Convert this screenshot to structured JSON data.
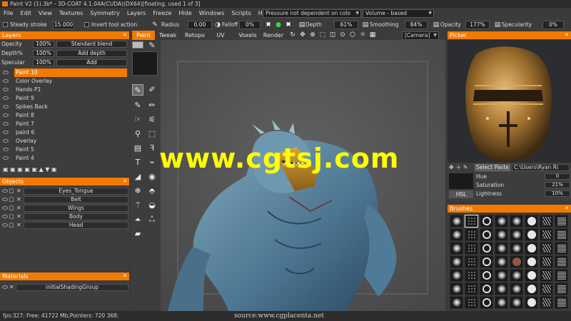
{
  "window": {
    "title": "Paint V2 (1).3b* - 3D-COAT 4.1.04A(CUDA)(DX64)[floating, used 1 of 3]"
  },
  "menu": [
    "File",
    "Edit",
    "View",
    "Textures",
    "Symmetry",
    "Layers",
    "Freeze",
    "Hide",
    "Windows",
    "Scripts",
    "Help"
  ],
  "menu_combos": {
    "pressure": "Pressure not dependent on colo",
    "volume": "Volume - based"
  },
  "toolbar": {
    "steady_stroke_label": "Steady stroke",
    "steady_stroke_value": "15.000",
    "invert_tool_label": "Invert tool action",
    "radius_label": "Radius",
    "radius_value": "0.00",
    "falloff_label": "Falloff",
    "falloff_value": "0%",
    "depth_label": "Depth",
    "depth_value": "61%",
    "smoothing_label": "Smoothing",
    "smoothing_value": "84%",
    "opacity_label": "Opacity",
    "opacity_value": "177%",
    "specularity_label": "Specularity",
    "specularity_value": "0%"
  },
  "rooms": {
    "tabs": [
      "Paint",
      "Tweak",
      "Retopo",
      "UV",
      "Voxels",
      "Render"
    ],
    "active": "Paint",
    "camera_combo": "[Camera]"
  },
  "layers_panel": {
    "title": "Layers",
    "opacity_label": "Opacity",
    "opacity_value": "100%",
    "blend_mode": "Standard blend",
    "depth_label": "Depth%",
    "depth_value": "100%",
    "depth_mode": "Add depth",
    "specular_label": "Specular",
    "specular_value": "100%",
    "specular_mode": "Add",
    "items": [
      "Paint 10",
      "Color Overlay",
      "Hands P1",
      "Paint 9",
      "Spikes Back",
      "Paint 8",
      "Paint 7",
      "paint 6",
      "Overlay",
      "Paint 5",
      "Paint 4"
    ],
    "selected": "Paint 10"
  },
  "objects_panel": {
    "title": "Objects",
    "items": [
      "Eyes_Tongue",
      "Belt",
      "Wings",
      "Body",
      "Head"
    ]
  },
  "materials_panel": {
    "title": "Materials",
    "items": [
      "initialShadingGroup"
    ]
  },
  "picker_panel": {
    "title": "Picker",
    "select_paste": "Select Paste",
    "path": "C:\\Users\\Ryan Ri",
    "hsl_label": "HSL",
    "hue_label": "Hue",
    "hue_value": "0",
    "saturation_label": "Saturation",
    "saturation_value": "21%",
    "lightness_label": "Lightness",
    "lightness_value": "10%"
  },
  "brushes_panel": {
    "title": "Brushes"
  },
  "status": {
    "text": "fps:327;   Free: 41722  Mb,Pointers: 720  368;"
  },
  "watermarks": {
    "main": "www.cgtsj.com",
    "source": "source:www.cgplacenta.net"
  },
  "colors": {
    "accent": "#f27a00",
    "watermark": "#ffff00"
  }
}
